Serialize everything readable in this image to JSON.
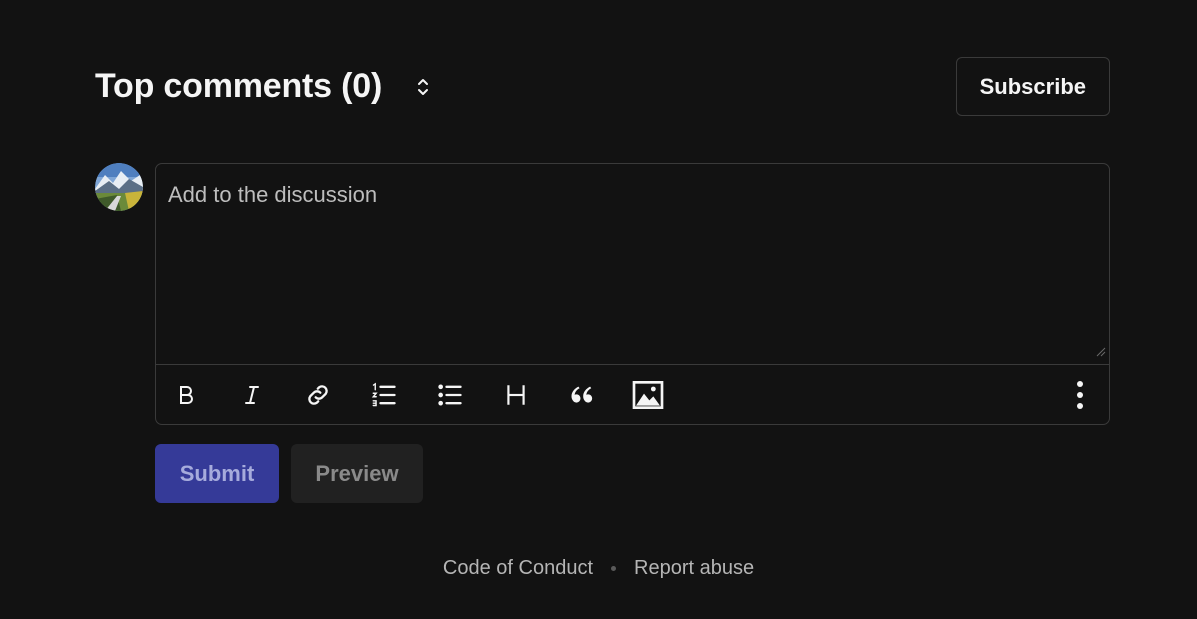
{
  "header": {
    "title": "Top comments (0)",
    "sort_icon": "chevron-up-down-icon",
    "subscribe_label": "Subscribe"
  },
  "avatar": {
    "alt": "user avatar"
  },
  "editor": {
    "placeholder": "Add to the discussion",
    "value": "",
    "toolbar": [
      {
        "name": "bold-icon",
        "title": "Bold"
      },
      {
        "name": "italic-icon",
        "title": "Italic"
      },
      {
        "name": "link-icon",
        "title": "Link"
      },
      {
        "name": "ordered-list-icon",
        "title": "Ordered list"
      },
      {
        "name": "unordered-list-icon",
        "title": "Unordered list"
      },
      {
        "name": "heading-icon",
        "title": "Heading"
      },
      {
        "name": "quote-icon",
        "title": "Quote"
      },
      {
        "name": "image-icon",
        "title": "Upload image"
      },
      {
        "name": "more-options-icon",
        "title": "More options"
      }
    ]
  },
  "actions": {
    "submit_label": "Submit",
    "preview_label": "Preview"
  },
  "footer": {
    "code_of_conduct": "Code of Conduct",
    "report_abuse": "Report abuse"
  },
  "colors": {
    "background": "#121212",
    "border": "#3a3a3a",
    "submit_bg": "#353a98",
    "submit_text": "#a6abdc",
    "preview_bg": "#212121",
    "text": "#f5f5f5"
  }
}
